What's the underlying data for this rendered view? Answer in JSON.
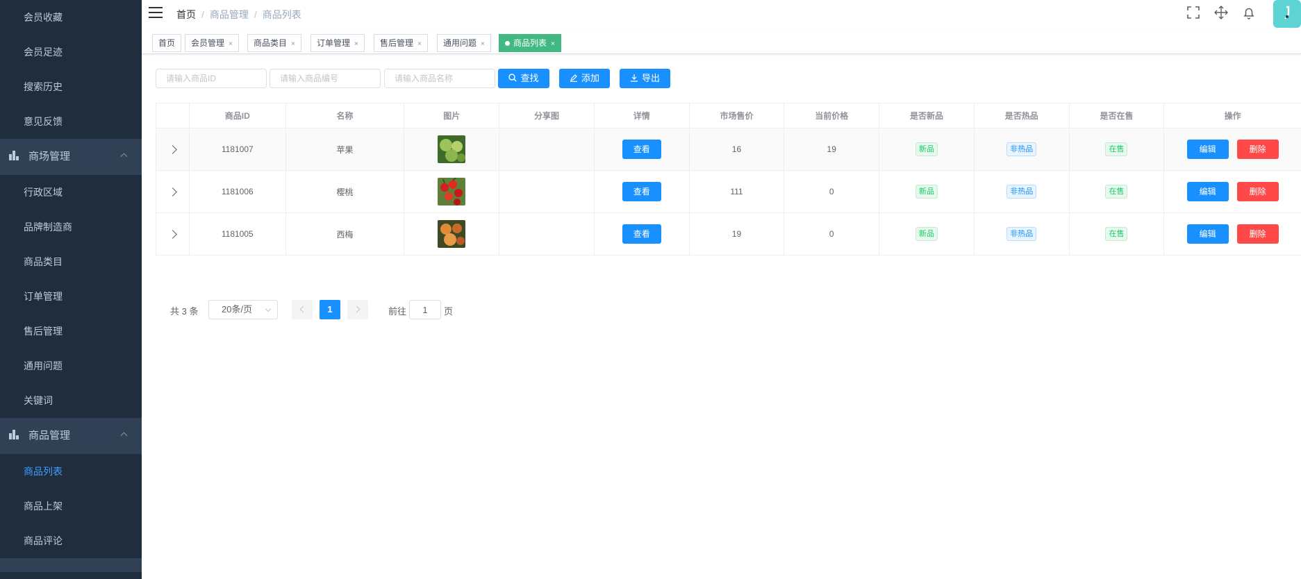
{
  "sidebar": {
    "items_top": [
      {
        "label": "会员收藏"
      },
      {
        "label": "会员足迹"
      },
      {
        "label": "搜索历史"
      },
      {
        "label": "意见反馈"
      }
    ],
    "group_mall": {
      "label": "商场管理"
    },
    "items_mall": [
      {
        "label": "行政区域"
      },
      {
        "label": "品牌制造商"
      },
      {
        "label": "商品类目"
      },
      {
        "label": "订单管理"
      },
      {
        "label": "售后管理"
      },
      {
        "label": "通用问题"
      },
      {
        "label": "关键词"
      }
    ],
    "group_goods": {
      "label": "商品管理"
    },
    "items_goods": [
      {
        "label": "商品列表",
        "active": true
      },
      {
        "label": "商品上架"
      },
      {
        "label": "商品评论"
      }
    ],
    "active_color": "#409eff",
    "bg_color": "#1f2d3d"
  },
  "breadcrumb": [
    "首页",
    "商品管理",
    "商品列表"
  ],
  "tags": [
    {
      "label": "首页"
    },
    {
      "label": "会员管理",
      "close": "×"
    },
    {
      "label": "商品类目",
      "close": "×"
    },
    {
      "label": "订单管理",
      "close": "×"
    },
    {
      "label": "售后管理",
      "close": "×"
    },
    {
      "label": "通用问题",
      "close": "×"
    },
    {
      "label": "商品列表",
      "close": "×",
      "active": true
    }
  ],
  "filters": {
    "goods_id_placeholder": "请输入商品ID",
    "goods_sn_placeholder": "请输入商品编号",
    "goods_name_placeholder": "请输入商品名称",
    "search_label": "查找",
    "add_label": "添加",
    "export_label": "导出"
  },
  "table": {
    "columns": [
      "商品ID",
      "名称",
      "图片",
      "分享图",
      "详情",
      "市场售价",
      "当前价格",
      "是否新品",
      "是否热品",
      "是否在售",
      "操作"
    ],
    "rows": [
      {
        "id": "1181007",
        "name": "苹果",
        "image": "green-fruit",
        "share": "",
        "detail": "查看",
        "market_price": "16",
        "current_price": "19",
        "is_new": "新品",
        "is_hot": "非热品",
        "on_sale": "在售",
        "edit": "编辑",
        "delete": "删除"
      },
      {
        "id": "1181006",
        "name": "樱桃",
        "image": "red-cherries",
        "share": "",
        "detail": "查看",
        "market_price": "111",
        "current_price": "0",
        "is_new": "新品",
        "is_hot": "非热品",
        "on_sale": "在售",
        "edit": "编辑",
        "delete": "删除"
      },
      {
        "id": "1181005",
        "name": "西梅",
        "image": "orange-plums",
        "share": "",
        "detail": "查看",
        "market_price": "19",
        "current_price": "0",
        "is_new": "新品",
        "is_hot": "非热品",
        "on_sale": "在售",
        "edit": "编辑",
        "delete": "删除"
      }
    ]
  },
  "pagination": {
    "total": "共 3 条",
    "page_size": "20条/页",
    "current_page": "1",
    "goto_prefix": "前往",
    "goto_value": "1",
    "goto_suffix": "页"
  },
  "colors": {
    "primary": "#1890ff",
    "danger": "#ff4949",
    "success": "#13ce66",
    "tag_active": "#42b983"
  }
}
